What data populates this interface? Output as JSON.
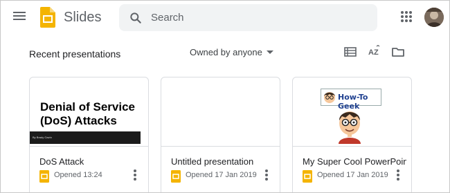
{
  "header": {
    "app_name": "Slides",
    "search_placeholder": "Search"
  },
  "toolbar": {
    "section_title": "Recent presentations",
    "owner_filter": "Owned by anyone",
    "sort_icon_label": "AZ"
  },
  "cards": [
    {
      "title": "DoS Attack",
      "meta": "Opened 13:24",
      "thumb_title": "Denial of Service (DoS) Attacks",
      "thumb_subtitle": "By Brady Gavin"
    },
    {
      "title": "Untitled presentation",
      "meta": "Opened 17 Jan 2019"
    },
    {
      "title": "My Super Cool PowerPoin",
      "meta": "Opened 17 Jan 2019",
      "thumb_logo_text": "How-To Geek"
    }
  ],
  "colors": {
    "slides_yellow": "#f4b400",
    "icon_gray": "#5f6368",
    "search_bg": "#f1f3f4"
  },
  "icons": [
    "menu-icon",
    "slides-logo",
    "search-icon",
    "apps-grid-icon",
    "avatar",
    "list-view-icon",
    "sort-az-icon",
    "folder-icon",
    "more-vert-icon"
  ]
}
